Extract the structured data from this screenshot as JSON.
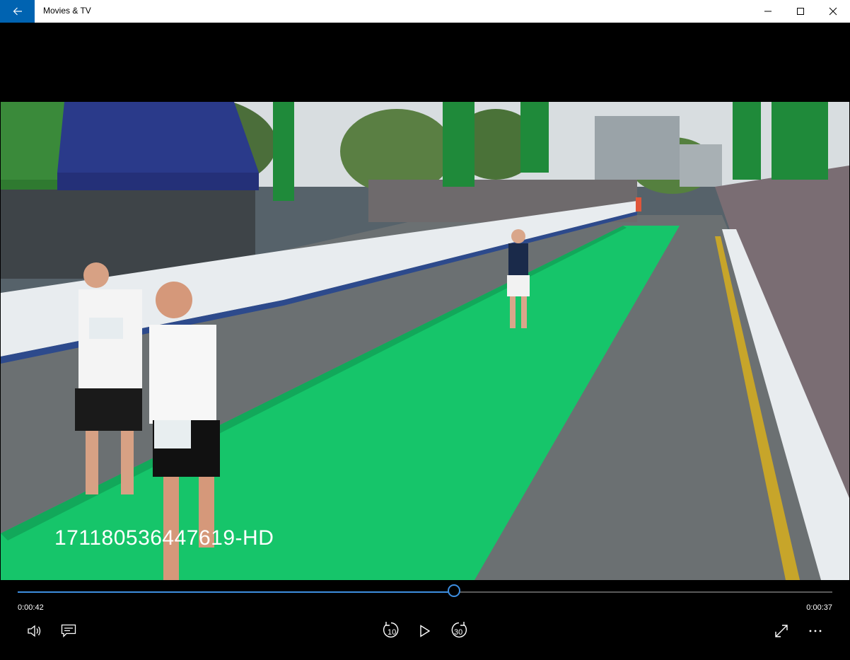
{
  "window": {
    "title": "Movies & TV"
  },
  "video": {
    "caption": "171180536447619-HD"
  },
  "playback": {
    "elapsed": "0:00:42",
    "remaining": "0:00:37",
    "progress": 0.536,
    "skip_back_label": "10",
    "skip_forward_label": "30"
  },
  "colors": {
    "accent": "#0063b1",
    "seek": "#3d8ee0"
  },
  "icons": {
    "back": "arrow-left-icon",
    "minimize": "minimize-icon",
    "maximize": "maximize-icon",
    "close": "close-icon",
    "volume": "speaker-icon",
    "subtitles": "subtitles-icon",
    "skip_back": "skip-back-10-icon",
    "play": "play-icon",
    "skip_forward": "skip-forward-30-icon",
    "fullscreen": "fullscreen-icon",
    "more": "more-icon"
  }
}
